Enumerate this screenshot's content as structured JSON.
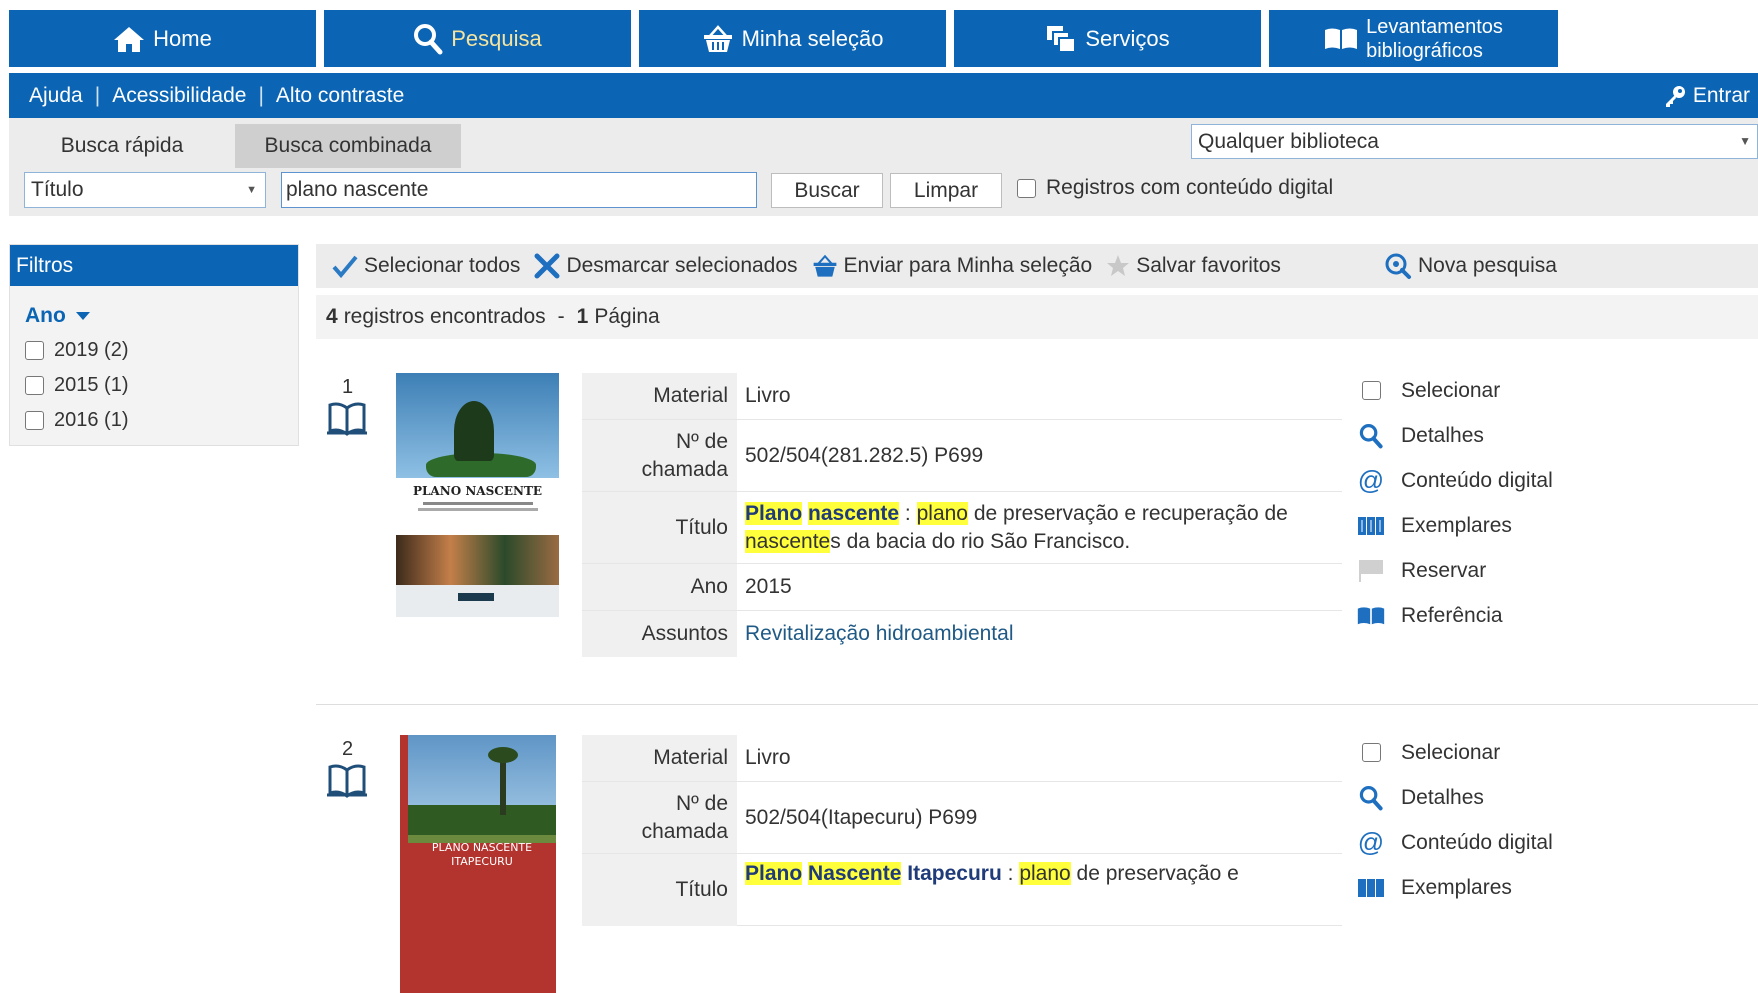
{
  "nav": {
    "home": "Home",
    "pesquisa": "Pesquisa",
    "selecao": "Minha seleção",
    "servicos": "Serviços",
    "levantamentos_1": "Levantamentos",
    "levantamentos_2": "bibliográficos"
  },
  "util": {
    "ajuda": "Ajuda",
    "sep": "|",
    "acessibilidade": "Acessibilidade",
    "contraste": "Alto contraste",
    "entrar": "Entrar"
  },
  "search": {
    "tab_rapida": "Busca rápida",
    "tab_combinada": "Busca combinada",
    "library": "Qualquer biblioteca",
    "field": "Título",
    "query": "plano nascente",
    "buscar": "Buscar",
    "limpar": "Limpar",
    "digital_label": "Registros com conteúdo digital"
  },
  "filters": {
    "header": "Filtros",
    "group": "Ano",
    "items": [
      "2019 (2)",
      "2015 (1)",
      "2016 (1)"
    ]
  },
  "actions": {
    "select_all": "Selecionar todos",
    "deselect": "Desmarcar selecionados",
    "send": "Enviar para Minha seleção",
    "save_fav": "Salvar favoritos",
    "new_search": "Nova pesquisa"
  },
  "results": {
    "count": "4",
    "count_label": "registros encontrados",
    "dash": "-",
    "pages": "1",
    "pages_label": "Página"
  },
  "labels": {
    "material": "Material",
    "chamada_1": "Nº de",
    "chamada_2": "chamada",
    "titulo": "Título",
    "ano": "Ano",
    "assuntos": "Assuntos"
  },
  "side": {
    "selecionar": "Selecionar",
    "detalhes": "Detalhes",
    "conteudo": "Conteúdo digital",
    "exemplares": "Exemplares",
    "reservar": "Reservar",
    "referencia": "Referência"
  },
  "records": [
    {
      "num": "1",
      "cover_title": "PLANO NASCENTE",
      "material": "Livro",
      "chamada": "502/504(281.282.5) P699",
      "title_parts": [
        "Plano",
        " ",
        "nascente",
        " : ",
        "plano",
        " de preservação e recuperação de ",
        "nascente",
        "s da bacia do rio São Francisco."
      ],
      "ano": "2015",
      "assuntos": "Revitalização hidroambiental"
    },
    {
      "num": "2",
      "cover_title_1": "PLANO NASCENTE",
      "cover_title_2": "ITAPECURU",
      "material": "Livro",
      "chamada": "502/504(Itapecuru) P699",
      "title_parts": [
        "Plano",
        " ",
        "Nascente",
        " ",
        "Itapecuru",
        " : ",
        "plano",
        " de preservação e"
      ]
    }
  ],
  "colors": {
    "primary": "#0b65b4",
    "highlight": "#ffff3b",
    "panel": "#ececec"
  }
}
